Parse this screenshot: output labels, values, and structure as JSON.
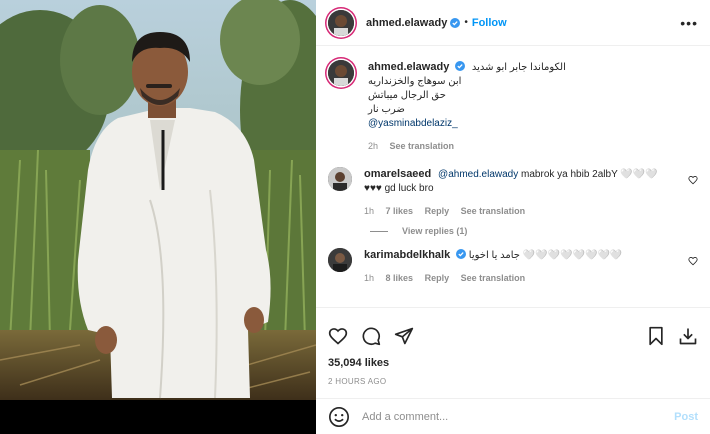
{
  "header": {
    "username": "ahmed.elawady",
    "separator": "•",
    "follow_label": "Follow",
    "more_label": "•••"
  },
  "caption": {
    "username": "ahmed.elawady",
    "lines": [
      "الكوماندا جابر ابو شديد",
      "ابن سوهاج والخزنداريه",
      "حق الرجال ميباتش",
      "ضرب نار"
    ],
    "mention": "@yasminabdelaziz_",
    "time": "2h",
    "translate": "See translation"
  },
  "comments": [
    {
      "username": "omarelsaeed",
      "mention": "@ahmed.elawady",
      "text": " mabrok ya hbib 2albY 🤍🤍🤍",
      "text2": "♥♥♥ gd luck bro",
      "time": "1h",
      "likes": "7 likes",
      "reply": "Reply",
      "translate": "See translation"
    },
    {
      "username": "karimabdelkhalk",
      "text": " جامد يا اخويا 🤍🤍🤍🤍🤍🤍🤍🤍",
      "time": "1h",
      "likes": "8 likes",
      "reply": "Reply",
      "translate": "See translation"
    }
  ],
  "view_replies": "View replies (1)",
  "likes": "35,094 likes",
  "posted": "2 HOURS AGO",
  "add_comment": {
    "placeholder": "Add a comment...",
    "post_label": "Post"
  },
  "colors": {
    "accent": "#0095f6",
    "verified": "#3897f0",
    "muted": "#8e8e8e"
  },
  "icons": [
    "heart-icon",
    "comment-icon",
    "share-icon",
    "bookmark-icon",
    "download-icon",
    "emoji-icon"
  ]
}
